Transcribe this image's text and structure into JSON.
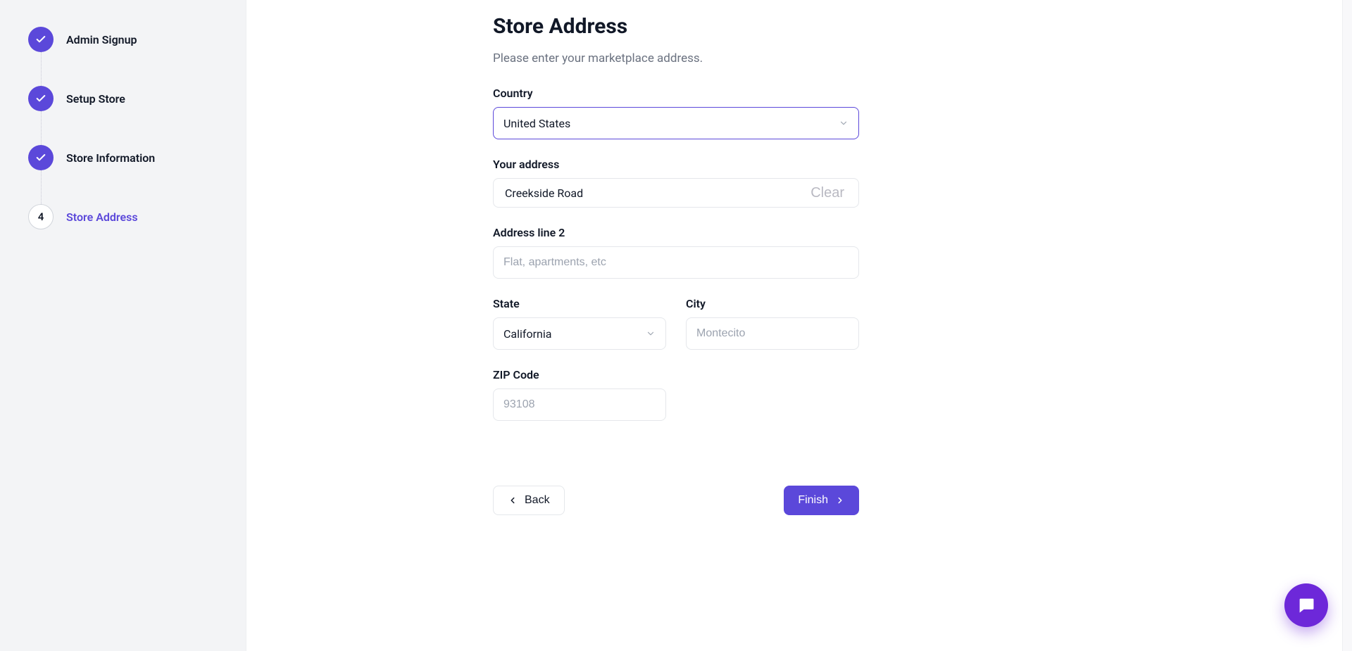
{
  "sidebar": {
    "steps": [
      {
        "label": "Admin Signup",
        "status": "done"
      },
      {
        "label": "Setup Store",
        "status": "done"
      },
      {
        "label": "Store Information",
        "status": "done"
      },
      {
        "label": "Store Address",
        "status": "active",
        "number": "4"
      }
    ]
  },
  "main": {
    "title": "Store Address",
    "subtitle": "Please enter your marketplace address.",
    "fields": {
      "country_label": "Country",
      "country_value": "United States",
      "address_label": "Your address",
      "address_value": "Creekside Road",
      "address_clear": "Clear",
      "address2_label": "Address line 2",
      "address2_placeholder": "Flat, apartments, etc",
      "address2_value": "",
      "state_label": "State",
      "state_value": "California",
      "city_label": "City",
      "city_placeholder": "Montecito",
      "city_value": "",
      "zip_label": "ZIP Code",
      "zip_placeholder": "93108",
      "zip_value": ""
    },
    "footer": {
      "back_label": "Back",
      "finish_label": "Finish"
    }
  },
  "icons": {
    "check": "check-icon",
    "chevron_down": "chevron-down-icon",
    "chevron_left": "chevron-left-icon",
    "chevron_right": "chevron-right-icon",
    "chat": "chat-icon"
  }
}
